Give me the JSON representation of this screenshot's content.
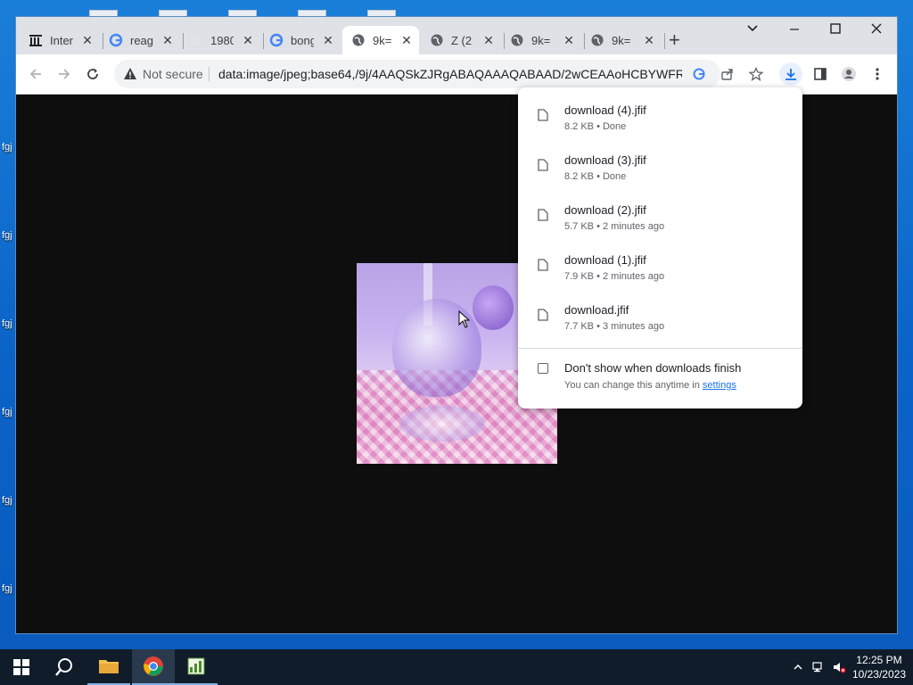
{
  "desktop": {
    "icon_labels": [
      "fgj",
      "fgj",
      "fgj",
      "fgj",
      "fgj",
      "fgj"
    ]
  },
  "browser": {
    "tabs": [
      {
        "title": "Inter",
        "icon": "archive-icon",
        "active": false
      },
      {
        "title": "reag",
        "icon": "google-icon",
        "active": false
      },
      {
        "title": "1980",
        "icon": "blank-page-icon",
        "active": false
      },
      {
        "title": "bong",
        "icon": "google-icon",
        "active": false
      },
      {
        "title": "9k=",
        "icon": "globe-icon",
        "active": true
      },
      {
        "title": "Z (2",
        "icon": "globe-icon",
        "active": false
      },
      {
        "title": "9k=",
        "icon": "globe-icon",
        "active": false
      },
      {
        "title": "9k=",
        "icon": "globe-icon",
        "active": false
      }
    ],
    "tab_close_glyph": "✕",
    "new_tab_glyph": "+",
    "omnibox": {
      "security_text": "Not secure",
      "url": "data:image/jpeg;base64,/9j/4AAQSkZJRgABAQAAAQABAAD/2wCEAAoHCBYWFRg..."
    }
  },
  "downloads": {
    "items": [
      {
        "name": "download (4).jfif",
        "status": "8.2 KB • Done"
      },
      {
        "name": "download (3).jfif",
        "status": "8.2 KB • Done"
      },
      {
        "name": "download (2).jfif",
        "status": "5.7 KB • 2 minutes ago"
      },
      {
        "name": "download (1).jfif",
        "status": "7.9 KB • 2 minutes ago"
      },
      {
        "name": "download.jfif",
        "status": "7.7 KB • 3 minutes ago"
      }
    ],
    "checkbox_label": "Don't show when downloads finish",
    "hint_text": "You can change this anytime in ",
    "hint_link": "settings"
  },
  "taskbar": {
    "time": "12:25 PM",
    "date": "10/23/2023"
  },
  "colors": {
    "accent": "#1a73e8",
    "tabstrip": "#dee1e6",
    "taskbar": "#101c2a"
  }
}
